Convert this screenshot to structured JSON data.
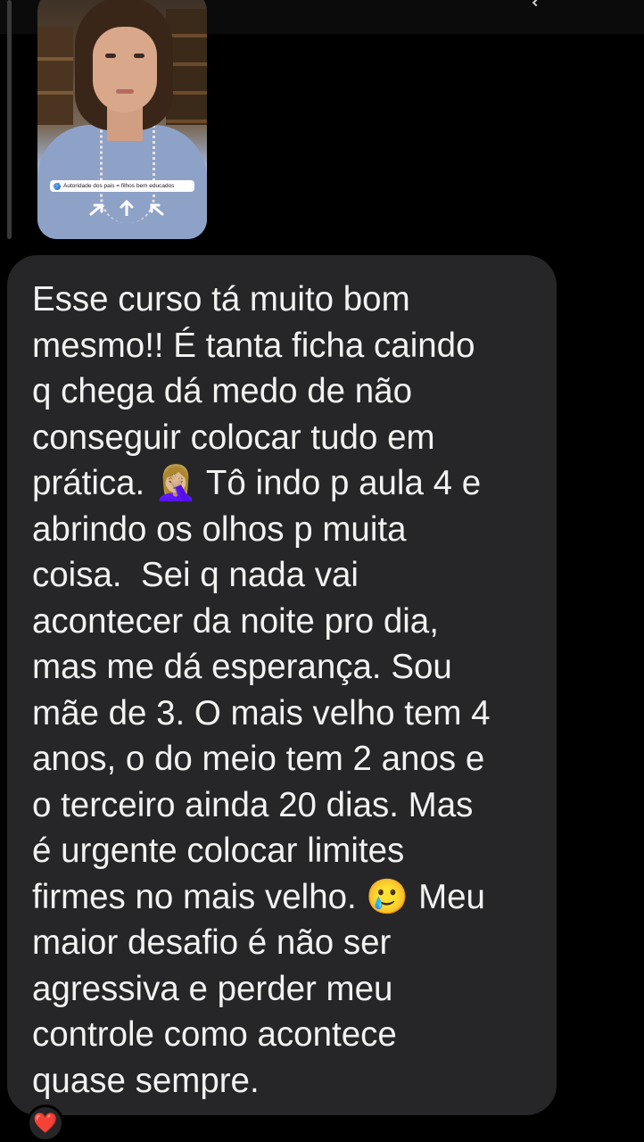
{
  "story_reply": {
    "caption": "Autoridade dos pais = filhos bem educados",
    "link_icon": "link-icon"
  },
  "message": {
    "text": "Esse curso tá muito bom\nmesmo!! É tanta ficha caindo\nq chega dá medo de não\nconseguir colocar tudo em\nprática. 🤦🏼‍♀️ Tô indo p aula 4 e\nabrindo os olhos p muita\ncoisa.  Sei q nada vai\nacontecer da noite pro dia,\nmas me dá esperança. Sou\nmãe de 3. O mais velho tem 4\nanos, o do meio tem 2 anos e\no terceiro ainda 20 dias. Mas\né urgente colocar limites\nfirmes no mais velho. 🥲 Meu\nmaior desafio é não ser\nagressiva e perder meu\ncontrole como acontece\nquase sempre."
  },
  "reaction": {
    "emoji": "❤️",
    "color": "#e0203a"
  },
  "colors": {
    "background": "#000000",
    "bubble": "#262628",
    "text": "#f2f2f2"
  }
}
